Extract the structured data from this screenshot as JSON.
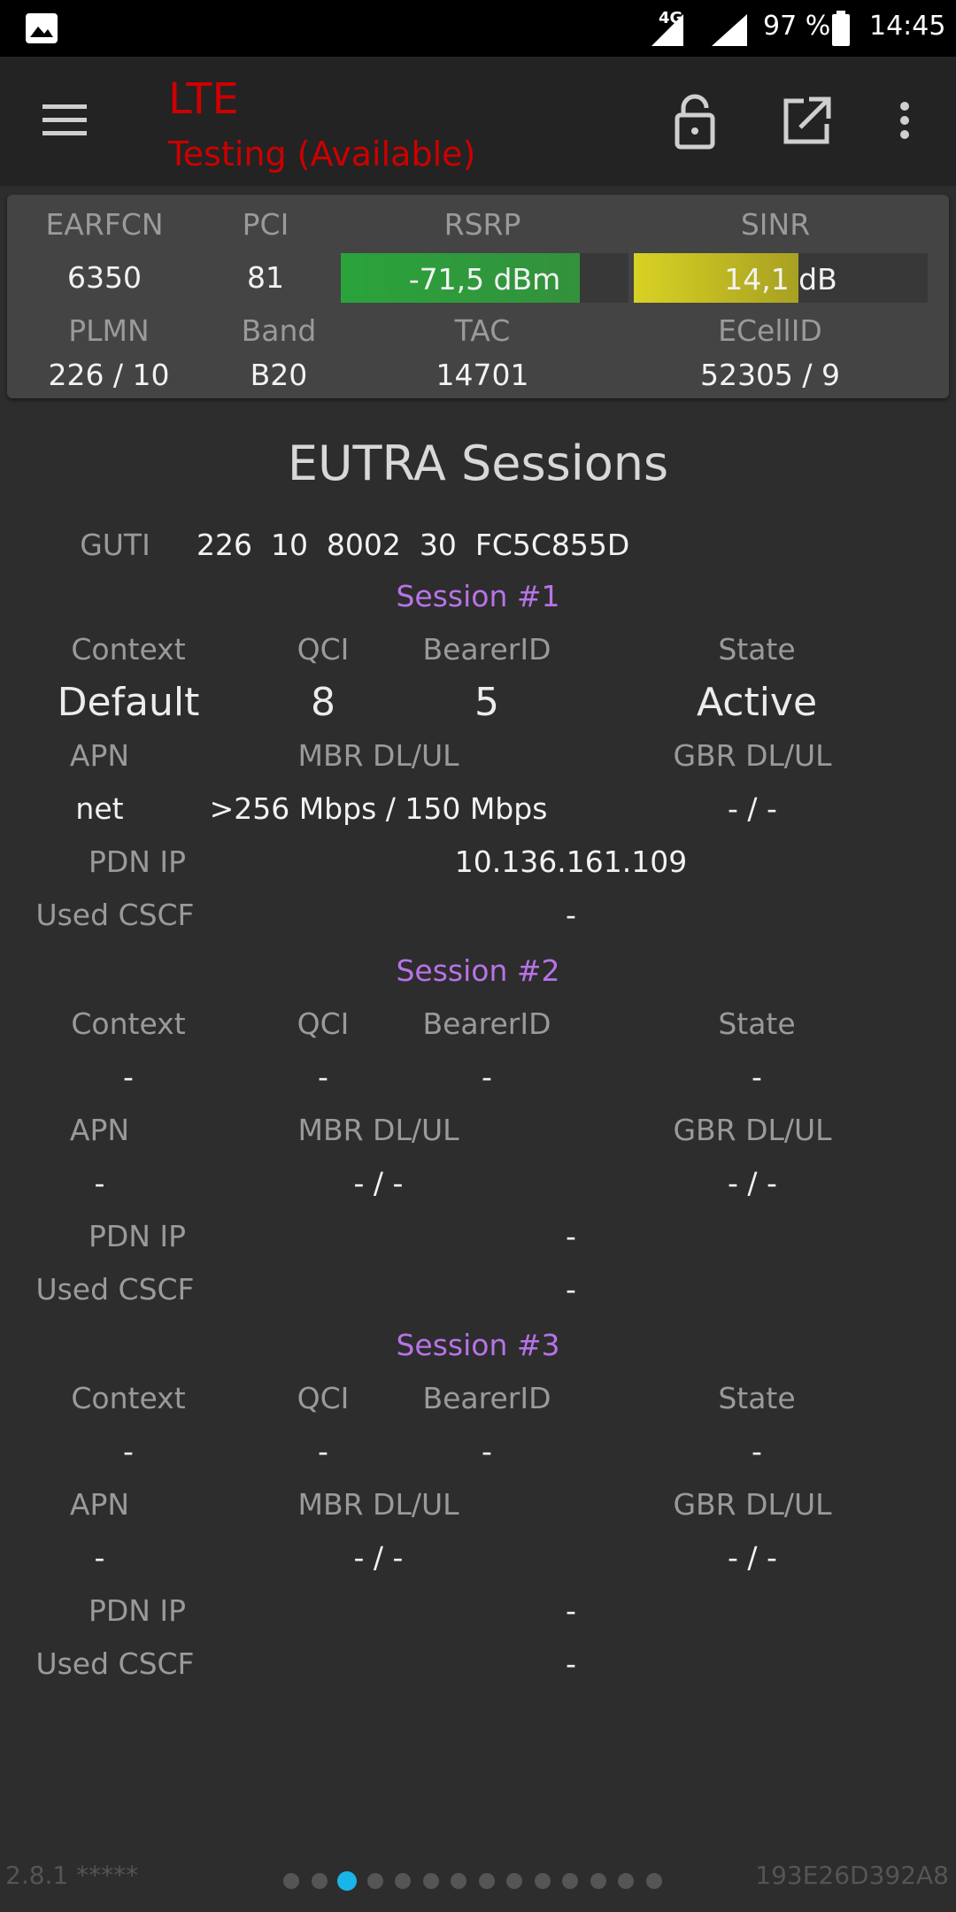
{
  "status_bar": {
    "image_icon": "image-icon",
    "network": "4G",
    "battery": "97 %",
    "time": "14:45"
  },
  "app_bar": {
    "title": "LTE",
    "subtitle": "Testing (Available)",
    "icons": [
      "menu-icon",
      "lock-icon",
      "open-external-icon",
      "more-vertical-icon"
    ]
  },
  "cell_panel": {
    "labels": {
      "earfcn": "EARFCN",
      "pci": "PCI",
      "rsrp": "RSRP",
      "sinr": "SINR",
      "plmn": "PLMN",
      "band": "Band",
      "tac": "TAC",
      "ecellid": "ECellID"
    },
    "values": {
      "earfcn": "6350",
      "pci": "81",
      "rsrp": "-71,5 dBm",
      "rsrp_fill_fraction": 0.83,
      "sinr": "14,1 dB",
      "sinr_fill_fraction": 0.56,
      "plmn": "226 / 10",
      "band": "B20",
      "tac": "14701",
      "ecellid": "52305 / 9"
    },
    "colors": {
      "rsrp_bar": "#2e9e3f",
      "sinr_bar": "#c8c51c"
    }
  },
  "eutra": {
    "heading": "EUTRA Sessions",
    "guti_label": "GUTI",
    "guti_value": "226  10  8002  30  FC5C855D",
    "labels": {
      "context": "Context",
      "qci": "QCI",
      "bearer_id": "BearerID",
      "state": "State",
      "apn": "APN",
      "mbr": "MBR DL/UL",
      "gbr": "GBR DL/UL",
      "pdn_ip": "PDN IP",
      "used_cscf": "Used CSCF"
    },
    "sessions": [
      {
        "title": "Session #1",
        "context": "Default",
        "qci": "8",
        "bearer_id": "5",
        "state": "Active",
        "apn": "net",
        "mbr": ">256 Mbps / 150 Mbps",
        "gbr": "- / -",
        "pdn_ip": "10.136.161.109",
        "used_cscf": "-"
      },
      {
        "title": "Session #2",
        "context": "-",
        "qci": "-",
        "bearer_id": "-",
        "state": "-",
        "apn": "-",
        "mbr": "- / -",
        "gbr": "- / -",
        "pdn_ip": "-",
        "used_cscf": "-"
      },
      {
        "title": "Session #3",
        "context": "-",
        "qci": "-",
        "bearer_id": "-",
        "state": "-",
        "apn": "-",
        "mbr": "- / -",
        "gbr": "- / -",
        "pdn_ip": "-",
        "used_cscf": "-"
      }
    ]
  },
  "footer": {
    "version": "2.8.1 *****",
    "device_id": "193E26D392A8",
    "page_count": 14,
    "active_page": 3
  }
}
